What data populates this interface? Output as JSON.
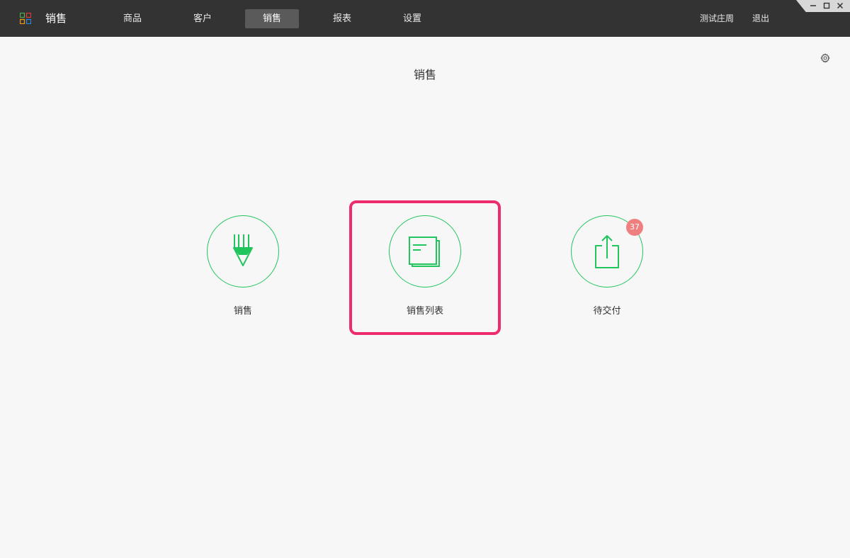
{
  "app": {
    "title": "销售"
  },
  "nav": {
    "items": [
      {
        "label": "商品"
      },
      {
        "label": "客户"
      },
      {
        "label": "销售",
        "active": true
      },
      {
        "label": "报表"
      },
      {
        "label": "设置"
      }
    ]
  },
  "header_right": {
    "user": "测试庄周",
    "logout": "退出"
  },
  "window_controls": {
    "minimize": "minimize-icon",
    "maximize": "maximize-icon",
    "close": "close-icon"
  },
  "page": {
    "title": "销售",
    "settings_icon": "gear-icon"
  },
  "tiles": [
    {
      "label": "销售",
      "icon": "pencil-icon"
    },
    {
      "label": "销售列表",
      "icon": "document-list-icon",
      "highlighted": true
    },
    {
      "label": "待交付",
      "icon": "share-upload-icon",
      "badge": "37"
    }
  ],
  "colors": {
    "topbar": "#333333",
    "accent": "#21c55d",
    "badge": "#f08080",
    "highlight": "#ee2b6c",
    "background": "#f7f7f7"
  }
}
